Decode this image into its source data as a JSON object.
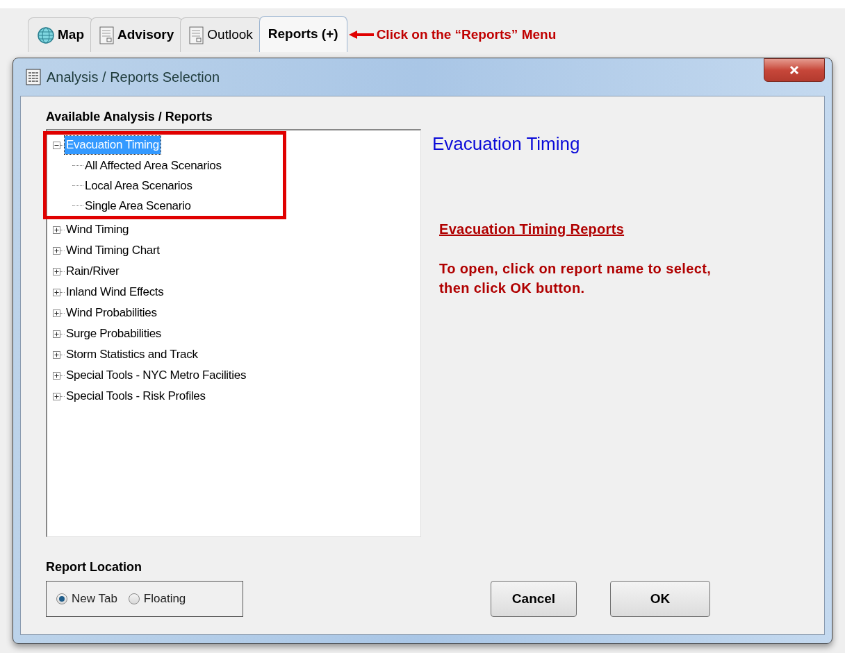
{
  "tabs": [
    {
      "label": "Map",
      "kind": "globe",
      "bold": true,
      "selected": false
    },
    {
      "label": "Advisory",
      "kind": "document",
      "bold": true,
      "selected": false
    },
    {
      "label": "Outlook",
      "kind": "document",
      "bold": false,
      "selected": false
    },
    {
      "label": "Reports (+)",
      "kind": "plain",
      "bold": true,
      "selected": true
    }
  ],
  "annotation": {
    "text": "Click on the “Reports” Menu"
  },
  "dialog": {
    "title": "Analysis / Reports Selection",
    "tree_label": "Available Analysis / Reports",
    "tree": [
      {
        "label": "Evacuation Timing",
        "expanded": true,
        "selected": true,
        "highlighted": true,
        "children": [
          {
            "label": "All Affected Area Scenarios",
            "selected": false
          },
          {
            "label": "Local Area Scenarios",
            "selected": false
          },
          {
            "label": "Single Area Scenario",
            "selected": false
          }
        ]
      },
      {
        "label": "Wind Timing",
        "expanded": false,
        "selected": false,
        "highlighted": false
      },
      {
        "label": "Wind Timing Chart",
        "expanded": false,
        "selected": false,
        "highlighted": false
      },
      {
        "label": "Rain/River",
        "expanded": false,
        "selected": false,
        "highlighted": false
      },
      {
        "label": "Inland Wind Effects",
        "expanded": false,
        "selected": false,
        "highlighted": false
      },
      {
        "label": "Wind Probabilities",
        "expanded": false,
        "selected": false,
        "highlighted": false
      },
      {
        "label": "Surge Probabilities",
        "expanded": false,
        "selected": false,
        "highlighted": false
      },
      {
        "label": "Storm Statistics and Track",
        "expanded": false,
        "selected": false,
        "highlighted": false
      },
      {
        "label": "Special Tools - NYC Metro Facilities",
        "expanded": false,
        "selected": false,
        "highlighted": false
      },
      {
        "label": "Special Tools - Risk Profiles",
        "expanded": false,
        "selected": false,
        "highlighted": false
      }
    ],
    "detail_title": "Evacuation Timing",
    "detail_heading": "Evacuation Timing Reports",
    "detail_text": "To open, click on report name to select, then click OK button.",
    "location_label": "Report Location",
    "location_options": [
      {
        "label": "New Tab",
        "selected": true
      },
      {
        "label": "Floating",
        "selected": false
      }
    ],
    "buttons": [
      "Cancel",
      "OK"
    ]
  }
}
